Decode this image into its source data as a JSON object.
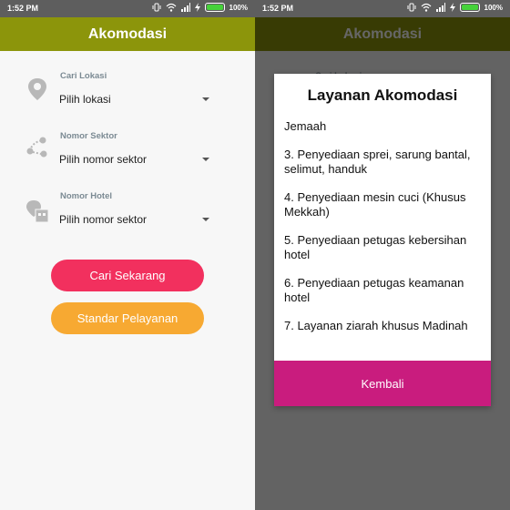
{
  "status_bar": {
    "time": "1:52 PM",
    "battery_text": "100%",
    "battery_level": 1.0,
    "icons": [
      "vibrate-icon",
      "wifi-icon",
      "signal-icon",
      "charging-icon",
      "battery-icon"
    ]
  },
  "app": {
    "title": "Akomodasi",
    "appbar_color": "#8c950b"
  },
  "form": {
    "lokasi": {
      "label": "Cari Lokasi",
      "value": "Pilih lokasi",
      "icon": "location-pin-icon"
    },
    "sektor": {
      "label": "Nomor Sektor",
      "value": "Pilih nomor sektor",
      "icon": "route-icon"
    },
    "hotel": {
      "label": "Nomor Hotel",
      "value": "Pilih nomor sektor",
      "icon": "hotel-icon"
    }
  },
  "buttons": {
    "search": "Cari Sekarang",
    "standard": "Standar Pelayanan"
  },
  "colors": {
    "primary_button": "#f2305e",
    "secondary_button": "#f7a932",
    "dialog_button": "#c91c7e"
  },
  "dialog": {
    "title": "Layanan Akomodasi",
    "items": [
      "Jemaah",
      "3. Penyediaan sprei, sarung bantal, selimut, handuk",
      "4. Penyediaan mesin cuci (Khusus Mekkah)",
      "5. Penyediaan petugas kebersihan hotel",
      "6. Penyediaan petugas keamanan hotel",
      "7. Layanan ziarah khusus Madinah"
    ],
    "close_label": "Kembali"
  }
}
